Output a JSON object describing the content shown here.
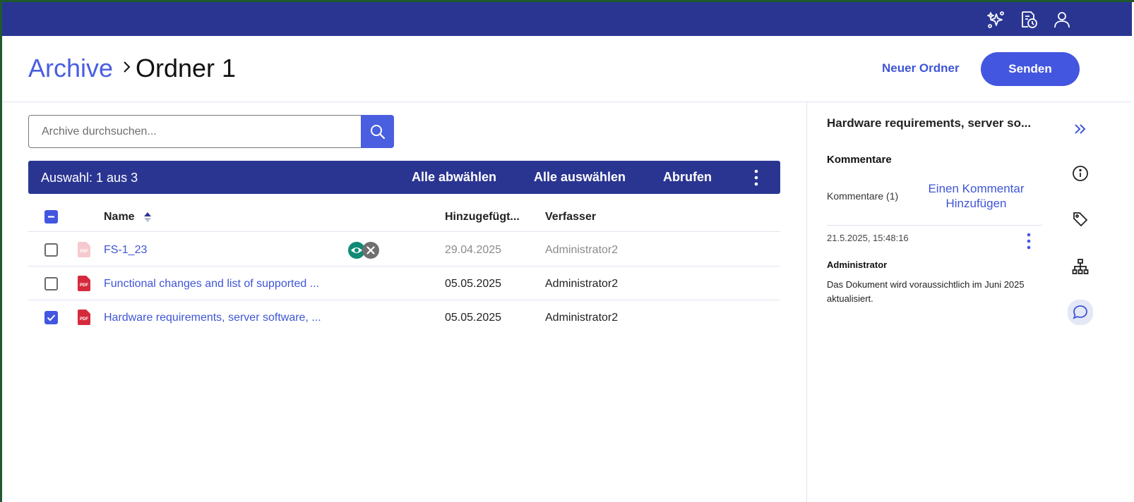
{
  "topbar": {
    "icons": [
      "sparkle-icon",
      "document-history-icon",
      "user-icon"
    ]
  },
  "breadcrumb": {
    "root": "Archive",
    "current": "Ordner 1"
  },
  "header": {
    "new_folder_label": "Neuer Ordner",
    "send_label": "Senden"
  },
  "search": {
    "placeholder": "Archive durchsuchen...",
    "value": ""
  },
  "selection_bar": {
    "count_text": "Auswahl: 1 aus 3",
    "deselect_all": "Alle abwählen",
    "select_all": "Alle auswählen",
    "retrieve": "Abrufen"
  },
  "table": {
    "columns": {
      "name": "Name",
      "added": "Hinzugefügt...",
      "author": "Verfasser"
    },
    "rows": [
      {
        "name": "FS-1_23",
        "added": "29.04.2025",
        "author": "Administrator2",
        "checked": false,
        "muted": true
      },
      {
        "name": "Functional changes and list of supported ...",
        "added": "05.05.2025",
        "author": "Administrator2",
        "checked": false,
        "muted": false
      },
      {
        "name": "Hardware requirements, server software, ...",
        "added": "05.05.2025",
        "author": "Administrator2",
        "checked": true,
        "muted": false
      }
    ]
  },
  "panel": {
    "title": "Hardware requirements, server so...",
    "section_title": "Kommentare",
    "comment_count": "Kommentare (1)",
    "add_comment": "Einen Kommentar Hinzufügen",
    "comment": {
      "date": "21.5.2025, 15:48:16",
      "author": "Administrator",
      "text": "Das Dokument wird voraussichtlich im Juni 2025 aktualisiert."
    }
  },
  "side_icons": [
    "collapse-panel-icon",
    "info-icon",
    "tag-icon",
    "hierarchy-icon",
    "comment-icon"
  ],
  "colors": {
    "navy": "#2a3592",
    "accent": "#4356e0",
    "link": "#3f55d6",
    "pdf_red": "#d42a3c"
  }
}
